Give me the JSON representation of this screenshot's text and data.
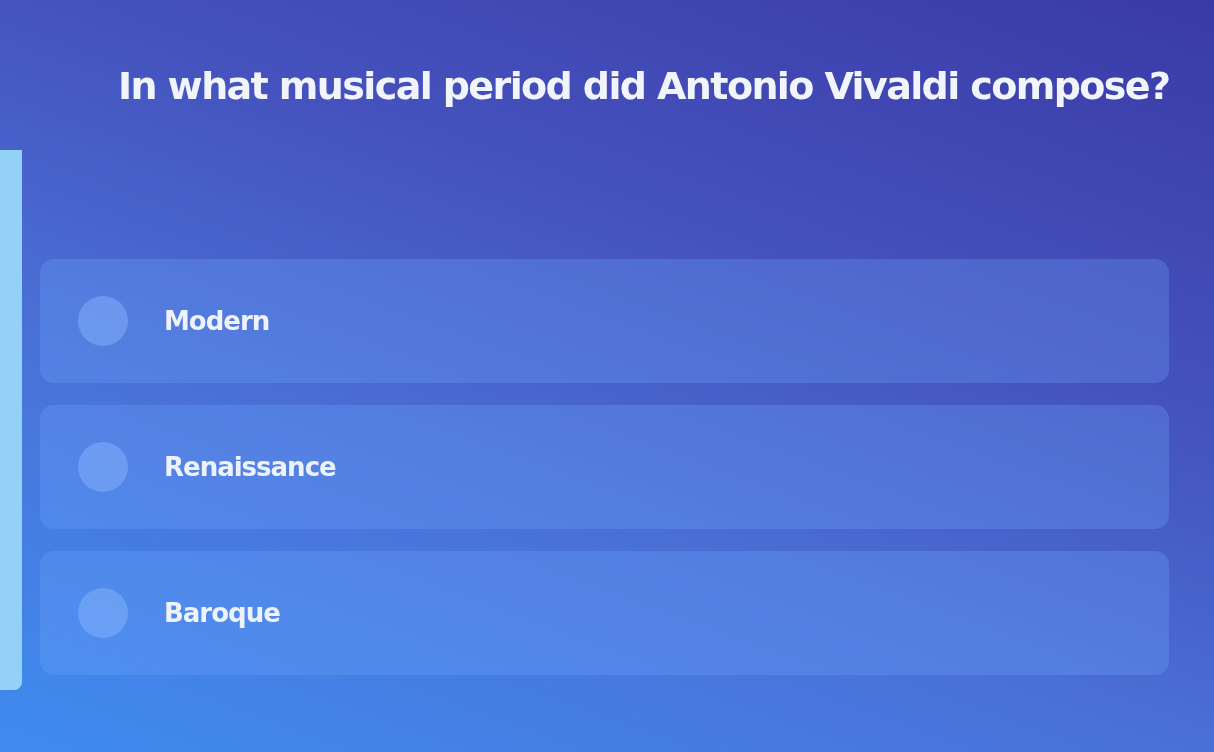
{
  "question": "In what musical period did Antonio Vivaldi compose?",
  "options": [
    {
      "label": "Modern",
      "selected": false
    },
    {
      "label": "Renaissance",
      "selected": false
    },
    {
      "label": "Baroque",
      "selected": false
    }
  ]
}
